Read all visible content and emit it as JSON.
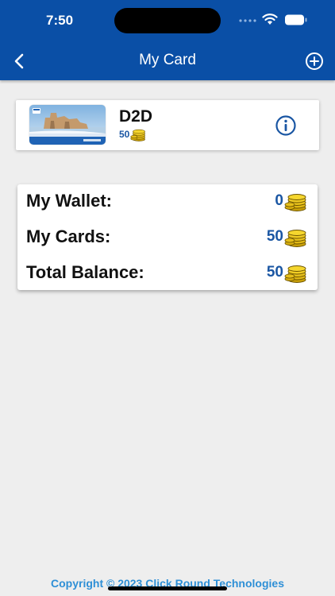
{
  "status_bar": {
    "time": "7:50"
  },
  "header": {
    "title": "My Card",
    "back_icon": "chevron-left-icon",
    "add_icon": "plus-circle-icon",
    "bg_color": "#0a4fa6"
  },
  "card": {
    "name": "D2D",
    "balance": "50",
    "info_icon": "info-icon",
    "coin_icon": "coins-icon"
  },
  "summary": {
    "rows": [
      {
        "label": "My Wallet:",
        "value": "0"
      },
      {
        "label": "My Cards:",
        "value": "50"
      },
      {
        "label": "Total Balance:",
        "value": "50"
      }
    ]
  },
  "footer": {
    "copyright": "Copyright © 2023 Click Round Technologies"
  },
  "colors": {
    "accent": "#1a56a3",
    "footer_text": "#2e8fd6",
    "background": "#eeeeee"
  }
}
